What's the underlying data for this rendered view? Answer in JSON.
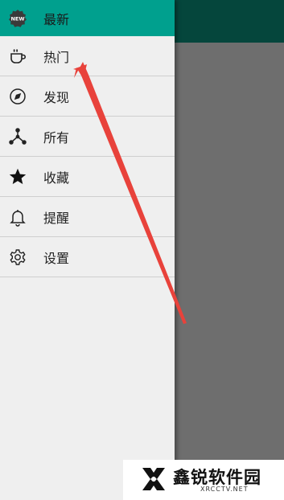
{
  "menu": {
    "items": [
      {
        "label": "最新",
        "icon": "new-badge-icon"
      },
      {
        "label": "热门",
        "icon": "cup-icon"
      },
      {
        "label": "发现",
        "icon": "compass-icon"
      },
      {
        "label": "所有",
        "icon": "share-nodes-icon"
      },
      {
        "label": "收藏",
        "icon": "star-icon"
      },
      {
        "label": "提醒",
        "icon": "bell-icon"
      },
      {
        "label": "设置",
        "icon": "gear-icon"
      }
    ],
    "badge_text": "NEW"
  },
  "colors": {
    "accent": "#00a08e",
    "appbar": "#05463c",
    "arrow": "#e8423b"
  },
  "watermark": {
    "title": "鑫锐软件园",
    "subtitle": "XRCCTV.NET"
  }
}
